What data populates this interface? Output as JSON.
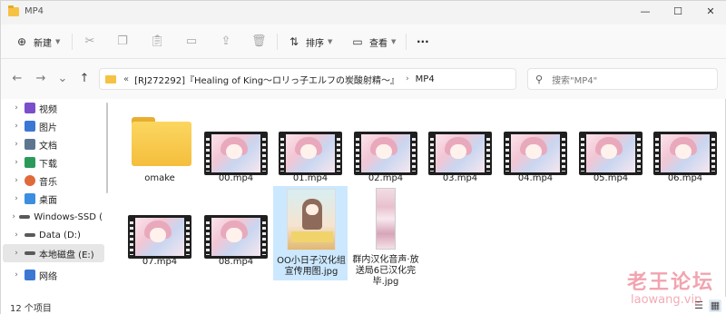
{
  "window": {
    "title": "MP4",
    "controls": {
      "minimize": "—",
      "maximize": "☐",
      "close": "✕"
    }
  },
  "toolbar": {
    "new_label": "新建",
    "sort_label": "排序",
    "view_label": "查看",
    "more_label": "···"
  },
  "nav": {
    "back": "←",
    "forward": "→",
    "recent": "⌄",
    "up": "↑"
  },
  "address": {
    "overflow": "«",
    "crumbs": [
      "[RJ272292]『Healing of King～ロリっ子エルフの炭酸射精～』",
      "MP4"
    ]
  },
  "search": {
    "placeholder": "搜索\"MP4\""
  },
  "sidebar": {
    "items": [
      {
        "label": "视频",
        "icon": "video-folder-icon",
        "color": "#7a4fc9"
      },
      {
        "label": "图片",
        "icon": "pictures-folder-icon",
        "color": "#3a78d4"
      },
      {
        "label": "文档",
        "icon": "documents-folder-icon",
        "color": "#5d7590"
      },
      {
        "label": "下载",
        "icon": "download-icon",
        "color": "#2a9a5a"
      },
      {
        "label": "音乐",
        "icon": "music-icon",
        "color": "#e06a3a"
      },
      {
        "label": "桌面",
        "icon": "desktop-icon",
        "color": "#3b8ee0"
      },
      {
        "label": "Windows-SSD (",
        "icon": "drive-icon",
        "color": "#5a5a5a"
      },
      {
        "label": "Data (D:)",
        "icon": "drive-icon",
        "color": "#5a5a5a"
      },
      {
        "label": "本地磁盘 (E:)",
        "icon": "drive-icon",
        "color": "#5a5a5a"
      },
      {
        "label": "网络",
        "icon": "network-icon",
        "color": "#3a78d4"
      }
    ]
  },
  "files": [
    {
      "name": "omake",
      "type": "folder"
    },
    {
      "name": "00.mp4",
      "type": "video"
    },
    {
      "name": "01.mp4",
      "type": "video"
    },
    {
      "name": "02.mp4",
      "type": "video"
    },
    {
      "name": "03.mp4",
      "type": "video"
    },
    {
      "name": "04.mp4",
      "type": "video"
    },
    {
      "name": "05.mp4",
      "type": "video"
    },
    {
      "name": "06.mp4",
      "type": "video"
    },
    {
      "name": "07.mp4",
      "type": "video"
    },
    {
      "name": "08.mp4",
      "type": "video"
    },
    {
      "name_line1": "OO小日子汉化组",
      "name_line2": "宣传用图.jpg",
      "type": "image",
      "selected": true
    },
    {
      "name_line1": "群内汉化音声·放",
      "name_line2": "送局6已汉化完",
      "name_line3": "毕.jpg",
      "type": "image-tall"
    }
  ],
  "status": {
    "count": "12 个项目"
  },
  "watermark": {
    "line1": "老王论坛",
    "line2": "laowang.vip"
  }
}
